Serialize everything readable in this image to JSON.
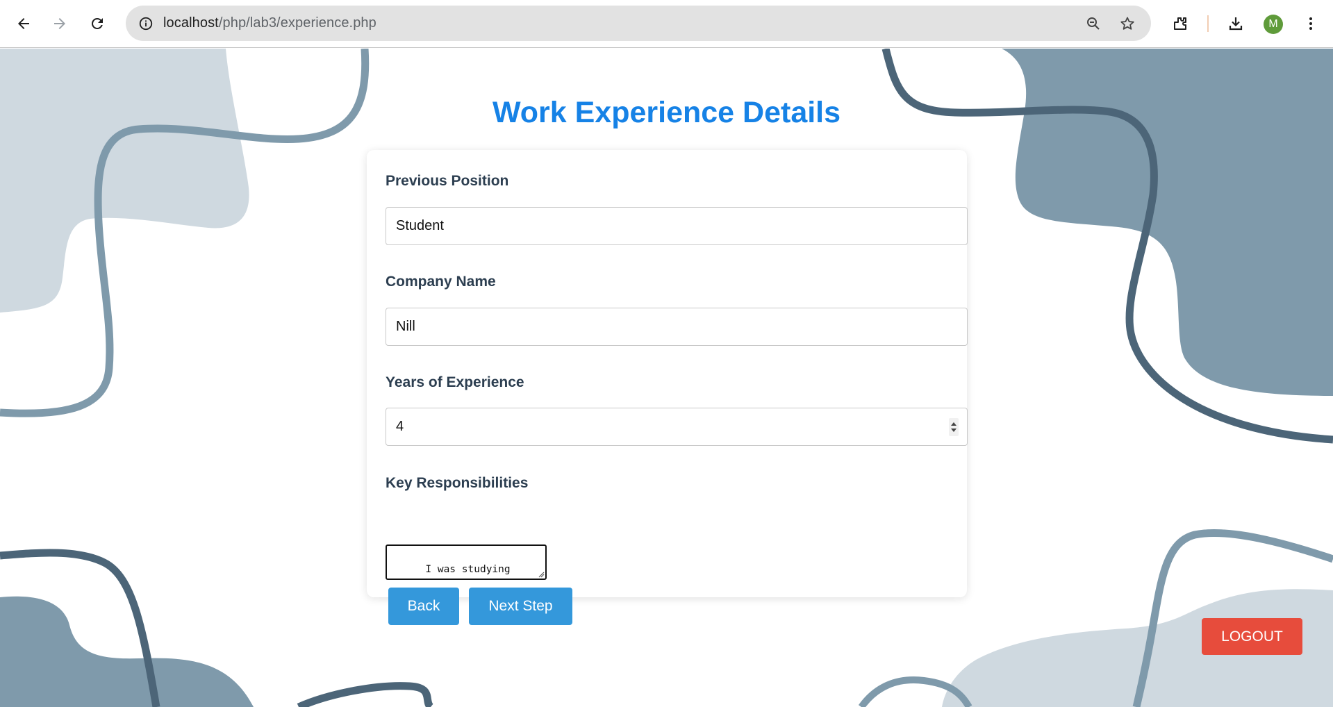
{
  "browser": {
    "url_host": "localhost",
    "url_path": "/php/lab3/experience.php",
    "profile_initial": "M",
    "icons": [
      "back-arrow-icon",
      "forward-arrow-icon",
      "reload-icon",
      "site-info-icon",
      "zoom-icon",
      "bookmark-star-icon",
      "extensions-icon",
      "download-icon",
      "kebab-menu-icon"
    ]
  },
  "page": {
    "title": "Work Experience Details",
    "fields": {
      "position": {
        "label": "Previous Position",
        "value": "Student"
      },
      "company": {
        "label": "Company Name",
        "value": "Nill"
      },
      "years": {
        "label": "Years of Experience",
        "value": "4"
      },
      "responsibilities": {
        "label": "Key Responsibilities",
        "value": "I was studying\nComputer Engineering"
      }
    },
    "buttons": {
      "back": "Back",
      "next": "Next Step",
      "logout": "LOGOUT"
    }
  },
  "colors": {
    "title": "#1682e6",
    "label": "#2c3e50",
    "button": "#3498db",
    "logout": "#e74c3c",
    "blob_light": "#cfd9e0",
    "blob_mid": "#7f9aab",
    "line_dark": "#4c6578"
  }
}
